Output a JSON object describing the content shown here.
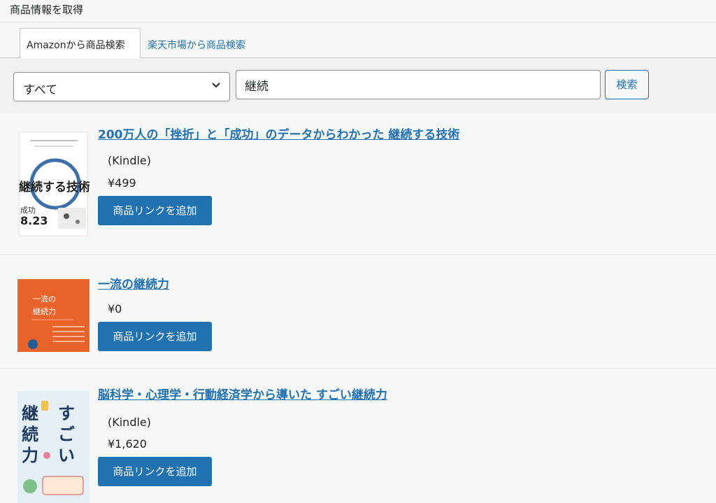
{
  "panel": {
    "title": "商品情報を取得"
  },
  "tabs": [
    {
      "label": "Amazonから商品検索",
      "active": true
    },
    {
      "label": "楽天市場から商品検索",
      "active": false
    }
  ],
  "search": {
    "category_selected": "すべて",
    "keyword_value": "継続",
    "button_label": "検索"
  },
  "colors": {
    "accent": "#2271b1",
    "background": "#f6f7f7"
  },
  "results": [
    {
      "title": "200万人の「挫折」と「成功」のデータからわかった 継続する技術",
      "binding": "(Kindle)",
      "price": "¥499",
      "add_label": "商品リンクを追加",
      "cover_text": [
        "継続する技術",
        "成功",
        "8.23"
      ]
    },
    {
      "title": "一流の継続力",
      "binding": "",
      "price": "¥0",
      "add_label": "商品リンクを追加",
      "cover_text": [
        "一流の",
        "継続力"
      ]
    },
    {
      "title": "脳科学・心理学・行動経済学から導いた すごい継続力",
      "binding": "(Kindle)",
      "price": "¥1,620",
      "add_label": "商品リンクを追加",
      "cover_text": [
        "継",
        "続",
        "力",
        "す",
        "ご",
        "い"
      ]
    }
  ]
}
